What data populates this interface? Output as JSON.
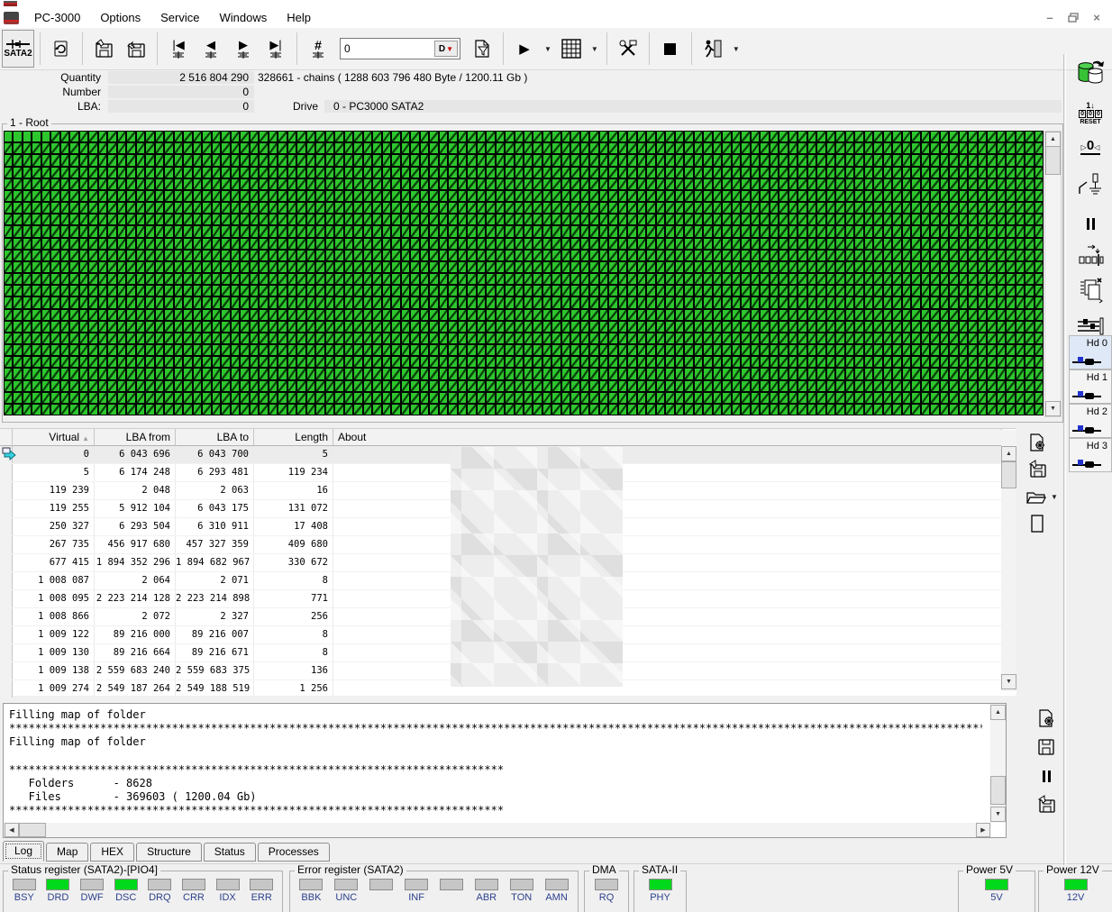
{
  "menubar": {
    "items": [
      "PC-3000",
      "Options",
      "Service",
      "Windows",
      "Help"
    ]
  },
  "window_controls": {
    "minimize": "–",
    "close": "×"
  },
  "toolbar": {
    "sata2_label": "SATA2",
    "goto_value": "0",
    "d_button_label": "D"
  },
  "info": {
    "quantity_label": "Quantity",
    "quantity_value": "2 516 804 290",
    "chains_text": "328661 - chains  ( 1288 603 796 480 Byte /  1200.11 Gb )",
    "number_label": "Number",
    "number_value": "0",
    "lba_label": "LBA:",
    "lba_value": "0",
    "drive_label": "Drive",
    "drive_value": "0 - PC3000 SATA2"
  },
  "map": {
    "title": "1 - Root",
    "cols": 110,
    "rows": 24,
    "plain_lead_cells": 5,
    "cell_color": "#2ec62e"
  },
  "table": {
    "columns": [
      "Virtual",
      "LBA from",
      "LBA to",
      "Length",
      "About"
    ],
    "selected_row": 0,
    "rows": [
      [
        "0",
        "6 043 696",
        "6 043 700",
        "5"
      ],
      [
        "5",
        "6 174 248",
        "6 293 481",
        "119 234"
      ],
      [
        "119 239",
        "2 048",
        "2 063",
        "16"
      ],
      [
        "119 255",
        "5 912 104",
        "6 043 175",
        "131 072"
      ],
      [
        "250 327",
        "6 293 504",
        "6 310 911",
        "17 408"
      ],
      [
        "267 735",
        "456 917 680",
        "457 327 359",
        "409 680"
      ],
      [
        "677 415",
        "1 894 352 296",
        "1 894 682 967",
        "330 672"
      ],
      [
        "1 008 087",
        "2 064",
        "2 071",
        "8"
      ],
      [
        "1 008 095",
        "2 223 214 128",
        "2 223 214 898",
        "771"
      ],
      [
        "1 008 866",
        "2 072",
        "2 327",
        "256"
      ],
      [
        "1 009 122",
        "89 216 000",
        "89 216 007",
        "8"
      ],
      [
        "1 009 130",
        "89 216 664",
        "89 216 671",
        "8"
      ],
      [
        "1 009 138",
        "2 559 683 240",
        "2 559 683 375",
        "136"
      ],
      [
        "1 009 274",
        "2 549 187 264",
        "2 549 188 519",
        "1 256"
      ]
    ]
  },
  "log": {
    "lines": [
      "Filling map of folder",
      "******************************************************************************************************************************************************",
      "Filling map of folder",
      "",
      "****************************************************************************",
      "   Folders      - 8628",
      "   Files        - 369603 ( 1200.04 Gb)",
      "****************************************************************************"
    ]
  },
  "tabs": {
    "active": "Log",
    "items": [
      "Log",
      "Map",
      "HEX",
      "Structure",
      "Status",
      "Processes"
    ]
  },
  "status_bar": {
    "colors": {
      "led_on": "#00d81c",
      "led_off": "#c6c6c6",
      "label": "#2b3f8c"
    },
    "groups": [
      {
        "id": "status_register",
        "title": "Status register (SATA2)-[PIO4]",
        "leds": [
          {
            "label": "BSY",
            "on": false
          },
          {
            "label": "DRD",
            "on": true
          },
          {
            "label": "DWF",
            "on": false
          },
          {
            "label": "DSC",
            "on": true
          },
          {
            "label": "DRQ",
            "on": false
          },
          {
            "label": "CRR",
            "on": false
          },
          {
            "label": "IDX",
            "on": false
          },
          {
            "label": "ERR",
            "on": false
          }
        ]
      },
      {
        "id": "error_register",
        "title": "Error register (SATA2)",
        "leds": [
          {
            "label": "BBK",
            "on": false
          },
          {
            "label": "UNC",
            "on": false
          },
          {
            "label": "",
            "on": false
          },
          {
            "label": "INF",
            "on": false
          },
          {
            "label": "",
            "on": false
          },
          {
            "label": "ABR",
            "on": false
          },
          {
            "label": "TON",
            "on": false
          },
          {
            "label": "AMN",
            "on": false
          }
        ]
      },
      {
        "id": "dma",
        "title": "DMA",
        "leds": [
          {
            "label": "RQ",
            "on": false
          }
        ]
      },
      {
        "id": "sata_ii",
        "title": "SATA-II",
        "leds": [
          {
            "label": "PHY",
            "on": true
          }
        ]
      },
      {
        "id": "power_5v",
        "title": "Power 5V",
        "leds": [
          {
            "label": "5V",
            "on": true
          }
        ]
      },
      {
        "id": "power_12v",
        "title": "Power 12V",
        "leds": [
          {
            "label": "12V",
            "on": true
          }
        ]
      }
    ]
  },
  "sidebar": {
    "reset_label": "RESET",
    "hd_buttons": [
      {
        "label": "Hd 0",
        "selected": true
      },
      {
        "label": "Hd 1",
        "selected": false
      },
      {
        "label": "Hd 2",
        "selected": false
      },
      {
        "label": "Hd 3",
        "selected": false
      }
    ]
  }
}
